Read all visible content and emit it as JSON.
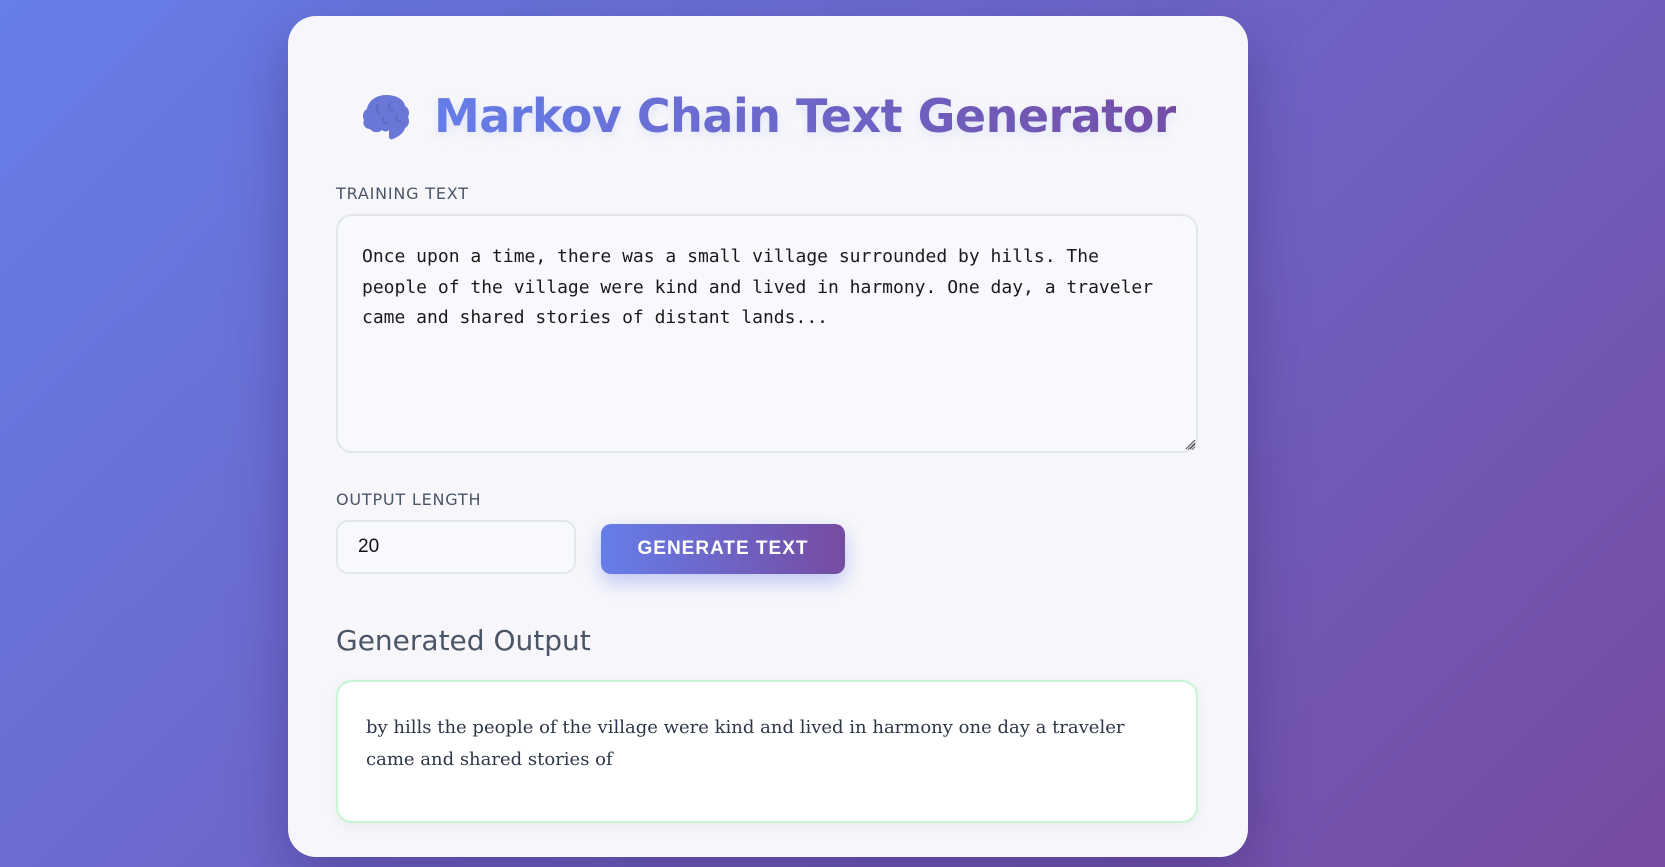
{
  "app": {
    "title": "Markov Chain Text Generator",
    "icon": "brain-icon"
  },
  "training": {
    "label": "TRAINING TEXT",
    "value": "Once upon a time, there was a small village surrounded by hills. The people of the village were kind and lived in harmony. One day, a traveler came and shared stories of distant lands..."
  },
  "output_length": {
    "label": "OUTPUT LENGTH",
    "value": "20"
  },
  "generate_button": {
    "label": "GENERATE TEXT"
  },
  "output": {
    "heading": "Generated Output",
    "text": "by hills the people of the village were kind and lived in harmony one day a traveler came and shared stories of"
  },
  "colors": {
    "gradient_start": "#667eea",
    "gradient_end": "#764ba2",
    "output_border": "#c6f6d5"
  }
}
